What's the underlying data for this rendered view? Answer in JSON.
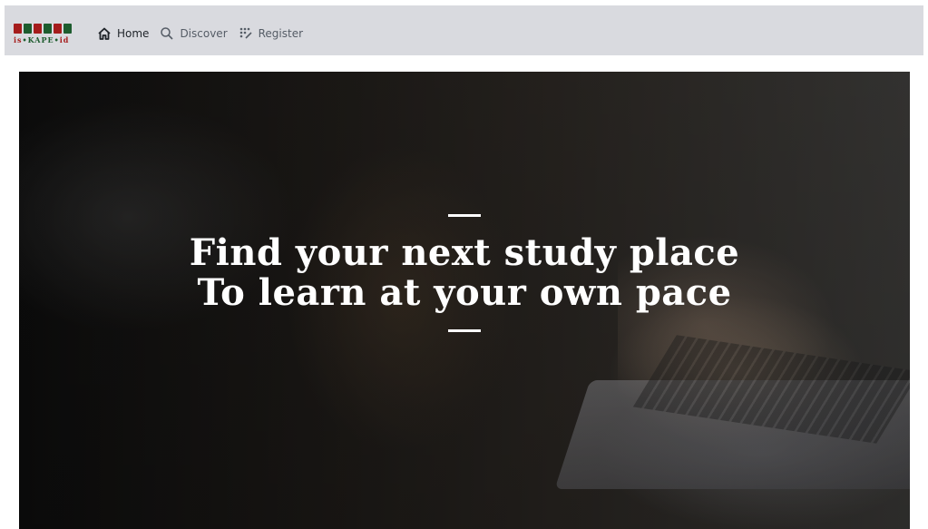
{
  "logo": {
    "text_left": "is",
    "text_main": "KAPE",
    "text_right": "id",
    "colors": [
      "#a51c1c",
      "#1d5c2e",
      "#a51c1c",
      "#1d5c2e",
      "#a51c1c",
      "#1d5c2e"
    ]
  },
  "nav": {
    "items": [
      {
        "label": "Home",
        "icon": "home-icon"
      },
      {
        "label": "Discover",
        "icon": "search-icon"
      },
      {
        "label": "Register",
        "icon": "register-icon"
      }
    ]
  },
  "hero": {
    "line1": "Find your next study place",
    "line2": "To learn at your own pace"
  },
  "colors": {
    "navbar_bg": "#d9dadf",
    "nav_text": "#555c66",
    "nav_active": "#1e2328"
  }
}
